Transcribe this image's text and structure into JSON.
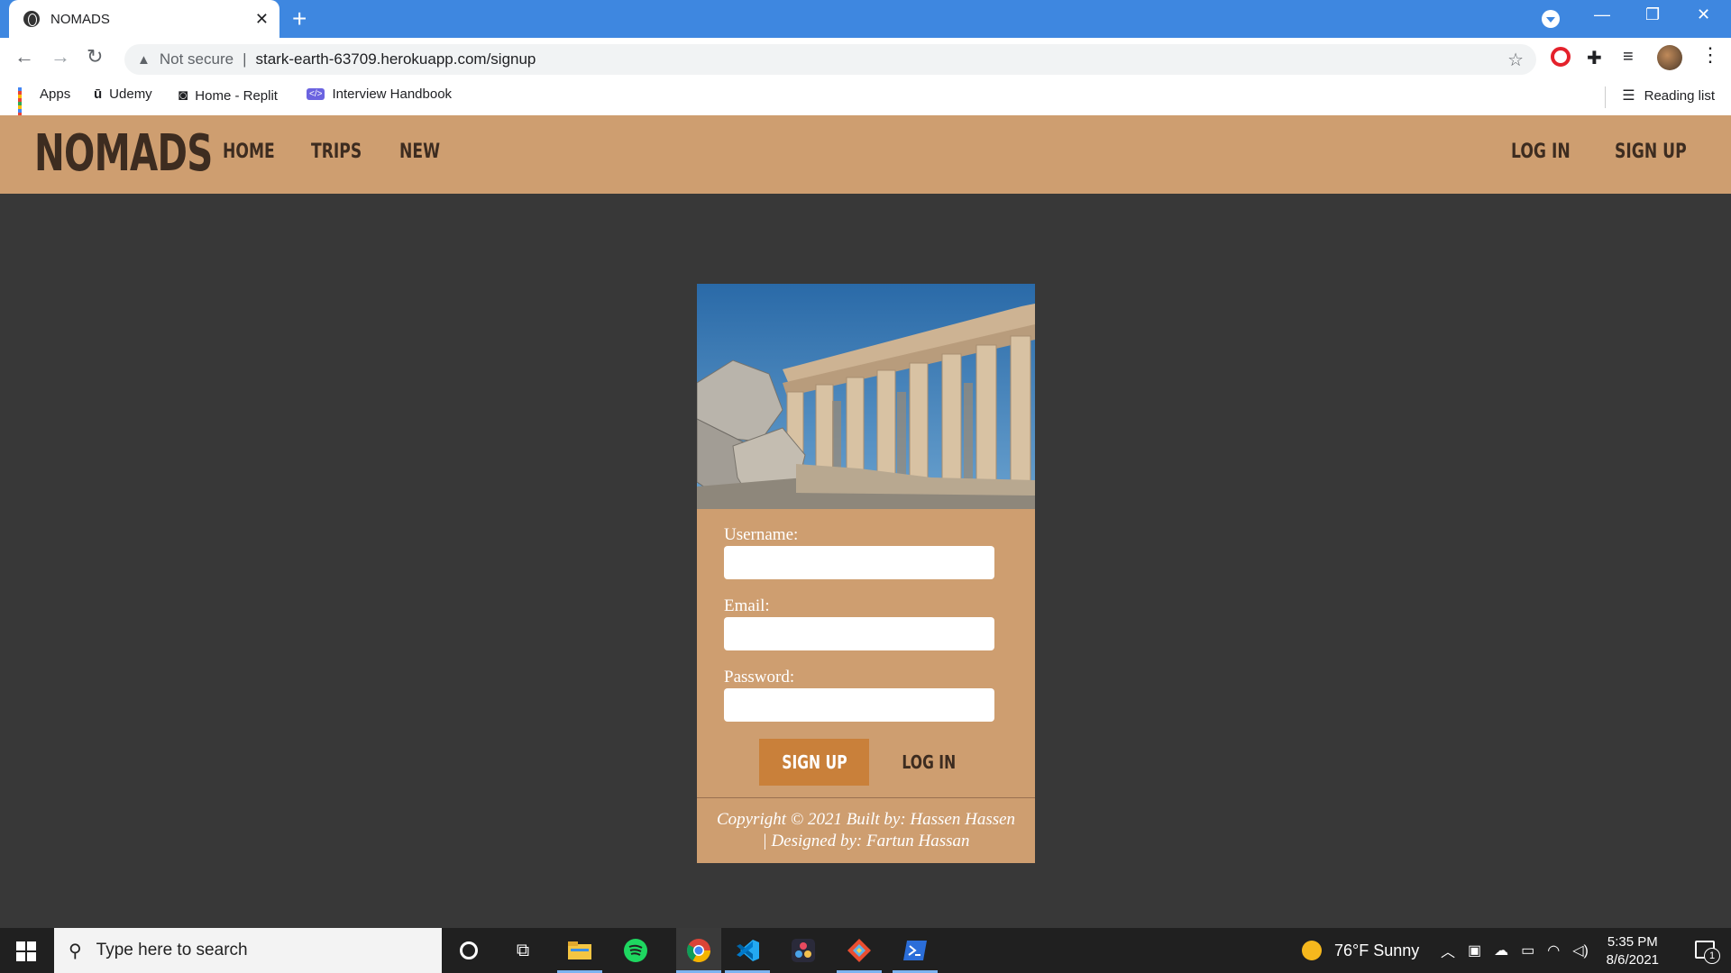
{
  "browser": {
    "tab_title": "NOMADS",
    "security_label": "Not secure",
    "url": "stark-earth-63709.herokuapp.com/signup",
    "bookmarks": [
      "Apps",
      "Udemy",
      "Home - Replit",
      "Interview Handbook"
    ],
    "reading_list": "Reading list"
  },
  "site": {
    "logo": "NOMADS",
    "nav_left": [
      "HOME",
      "TRIPS",
      "NEW"
    ],
    "nav_right": [
      "LOG IN",
      "SIGN UP"
    ]
  },
  "signup_form": {
    "username_label": "Username:",
    "username_value": "",
    "email_label": "Email:",
    "email_value": "",
    "password_label": "Password:",
    "password_value": "",
    "submit_label": "SIGN UP",
    "login_link": "LOG IN"
  },
  "footer": {
    "line1": "Copyright © 2021 Built by: Hassen Hassen",
    "line2": "| Designed by: Fartun Hassan"
  },
  "taskbar": {
    "search_placeholder": "Type here to search",
    "weather": "76°F  Sunny",
    "time": "5:35 PM",
    "date": "8/6/2021",
    "notification_count": "1"
  },
  "icons": {
    "hero_image": "parthenon-ruins-photo",
    "colors": {
      "nav_bg": "#ce9e70",
      "page_bg": "#383838",
      "button_bg": "#c9803a",
      "logo_text": "#3d2c20"
    }
  }
}
